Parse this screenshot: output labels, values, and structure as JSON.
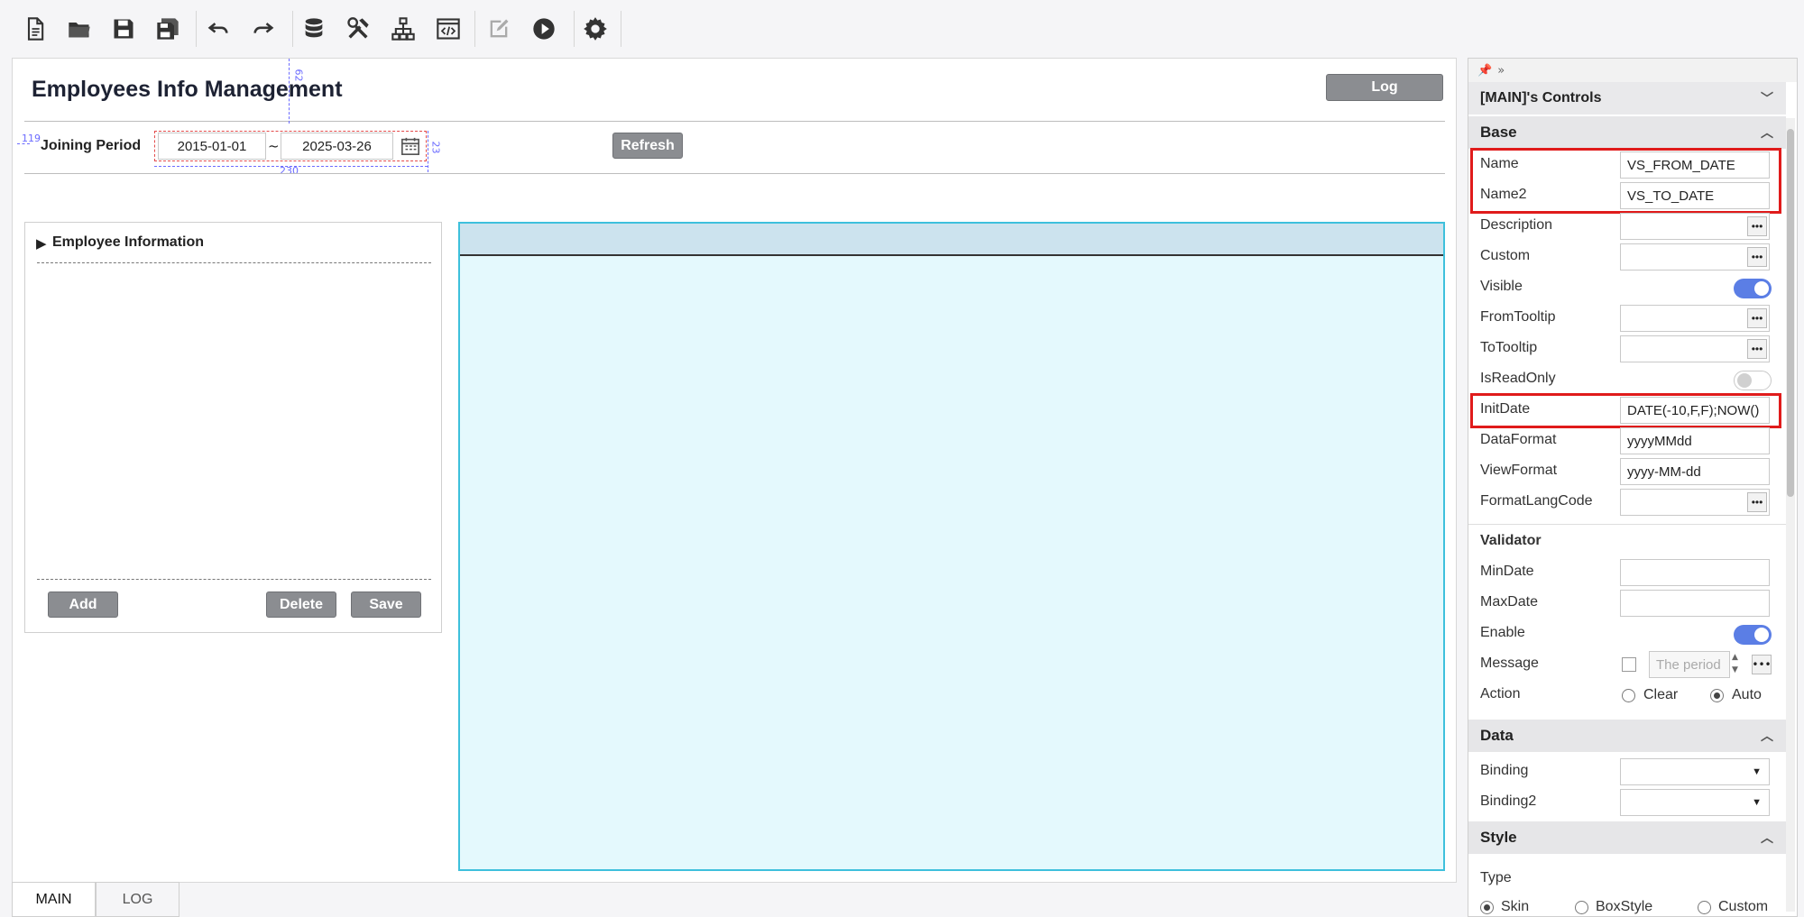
{
  "toolbar": {
    "buttons": [
      "new-file-icon",
      "open-folder-icon",
      "save-icon",
      "save-all-icon",
      "undo-icon",
      "redo-icon",
      "database-icon",
      "tools-icon",
      "hierarchy-icon",
      "code-view-icon",
      "edit-icon",
      "run-icon",
      "settings-icon"
    ]
  },
  "designer": {
    "title": "Employees Info Management",
    "log_button": "Log",
    "joining_label": "Joining Period",
    "from_date": "2015-01-01",
    "tilde": "~",
    "to_date": "2025-03-26",
    "refresh_button": "Refresh",
    "guide_top": "62",
    "guide_left": "119",
    "guide_width": "230",
    "guide_height": "23",
    "emp_panel": {
      "heading": "Employee Information",
      "add_button": "Add",
      "delete_button": "Delete",
      "save_button": "Save"
    }
  },
  "tabs": [
    {
      "label": "MAIN"
    },
    {
      "label": "LOG"
    }
  ],
  "properties": {
    "header": "[MAIN]'s Controls",
    "base": {
      "title": "Base",
      "name_label": "Name",
      "name_value": "VS_FROM_DATE",
      "name2_label": "Name2",
      "name2_value": "VS_TO_DATE",
      "description_label": "Description",
      "custom_label": "Custom",
      "visible_label": "Visible",
      "fromtooltip_label": "FromTooltip",
      "totooltip_label": "ToTooltip",
      "isreadonly_label": "IsReadOnly",
      "initdate_label": "InitDate",
      "initdate_value": "DATE(-10,F,F);NOW()",
      "dataformat_label": "DataFormat",
      "dataformat_value": "yyyyMMdd",
      "viewformat_label": "ViewFormat",
      "viewformat_value": "yyyy-MM-dd",
      "formatlangcode_label": "FormatLangCode"
    },
    "validator": {
      "title": "Validator",
      "mindate_label": "MinDate",
      "maxdate_label": "MaxDate",
      "enable_label": "Enable",
      "message_label": "Message",
      "message_placeholder": "The period",
      "action_label": "Action",
      "action_clear": "Clear",
      "action_auto": "Auto"
    },
    "data": {
      "title": "Data",
      "binding_label": "Binding",
      "binding2_label": "Binding2"
    },
    "style": {
      "title": "Style",
      "type_label": "Type",
      "skin": "Skin",
      "boxstyle": "BoxStyle",
      "custom": "Custom"
    }
  }
}
